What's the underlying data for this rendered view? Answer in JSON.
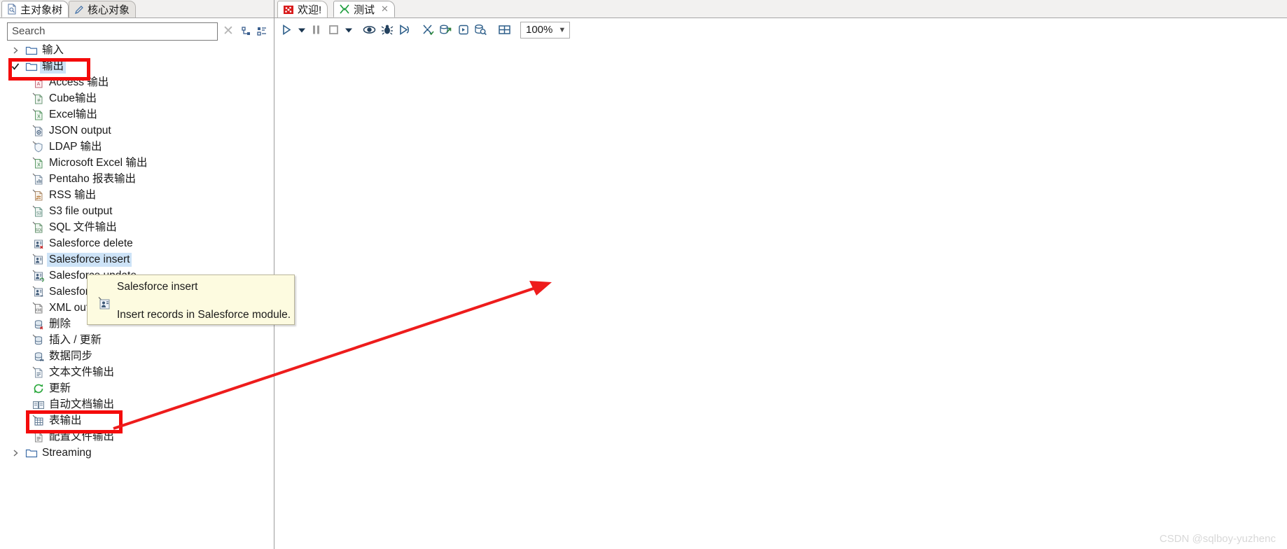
{
  "left_panel": {
    "tabs": [
      {
        "label": "主对象树",
        "icon": "document-tree-icon",
        "active": true
      },
      {
        "label": "核心对象",
        "icon": "pencil-icon",
        "active": false
      }
    ],
    "search": {
      "placeholder": "Search",
      "value": ""
    },
    "toolbar_icons": [
      {
        "name": "collapse-all-icon"
      },
      {
        "name": "expand-all-icon"
      }
    ],
    "clear_icon": "clear-x-icon",
    "tree": [
      {
        "label": "输入",
        "level": "root",
        "icon": "folder-icon",
        "twist": "collapsed"
      },
      {
        "label": "输出",
        "level": "root",
        "icon": "folder-icon",
        "twist": "expanded",
        "selected": true,
        "highlighted": true
      },
      {
        "label": "Access 输出",
        "level": "child",
        "icon": "access-output-icon"
      },
      {
        "label": "Cube输出",
        "level": "child",
        "icon": "cube-output-icon"
      },
      {
        "label": "Excel输出",
        "level": "child",
        "icon": "excel-output-icon"
      },
      {
        "label": "JSON output",
        "level": "child",
        "icon": "json-output-icon"
      },
      {
        "label": "LDAP 输出",
        "level": "child",
        "icon": "ldap-output-icon"
      },
      {
        "label": "Microsoft Excel 输出",
        "level": "child",
        "icon": "ms-excel-output-icon"
      },
      {
        "label": "Pentaho 报表输出",
        "level": "child",
        "icon": "pentaho-report-output-icon"
      },
      {
        "label": "RSS 输出",
        "level": "child",
        "icon": "rss-output-icon"
      },
      {
        "label": "S3 file output",
        "level": "child",
        "icon": "s3-file-output-icon"
      },
      {
        "label": "SQL 文件输出",
        "level": "child",
        "icon": "sql-file-output-icon"
      },
      {
        "label": "Salesforce delete",
        "level": "child",
        "icon": "salesforce-delete-icon"
      },
      {
        "label": "Salesforce insert",
        "level": "child",
        "icon": "salesforce-insert-icon",
        "selected": true
      },
      {
        "label": "Salesforce update",
        "level": "child",
        "icon": "salesforce-update-icon"
      },
      {
        "label": "Salesforce upsert",
        "level": "child",
        "icon": "salesforce-upsert-icon"
      },
      {
        "label": "XML output",
        "level": "child",
        "icon": "xml-output-icon"
      },
      {
        "label": "删除",
        "level": "child",
        "icon": "delete-icon"
      },
      {
        "label": "插入 / 更新",
        "level": "child",
        "icon": "insert-update-icon"
      },
      {
        "label": "数据同步",
        "level": "child",
        "icon": "data-sync-icon"
      },
      {
        "label": "文本文件输出",
        "level": "child",
        "icon": "text-file-output-icon"
      },
      {
        "label": "更新",
        "level": "child",
        "icon": "update-icon"
      },
      {
        "label": "自动文档输出",
        "level": "child",
        "icon": "auto-doc-output-icon"
      },
      {
        "label": "表输出",
        "level": "child",
        "icon": "table-output-icon",
        "highlighted": true
      },
      {
        "label": "配置文件输出",
        "level": "child",
        "icon": "properties-output-icon"
      },
      {
        "label": "Streaming",
        "level": "root",
        "icon": "folder-icon",
        "twist": "collapsed"
      }
    ]
  },
  "tooltip": {
    "title": "Salesforce insert",
    "description": "Insert records in Salesforce module.",
    "icon": "salesforce-insert-icon"
  },
  "right_panel": {
    "tabs": [
      {
        "label": "欢迎!",
        "icon": "welcome-icon",
        "active": false,
        "closeable": false
      },
      {
        "label": "测试",
        "icon": "transformation-icon",
        "active": true,
        "closeable": true,
        "close_label": "✕"
      }
    ],
    "toolbar": [
      {
        "name": "run-button",
        "icon": "play-icon"
      },
      {
        "name": "run-options-dropdown",
        "icon": "chevron-down-icon"
      },
      {
        "name": "pause-button",
        "icon": "pause-icon"
      },
      {
        "name": "stop-button",
        "icon": "stop-icon"
      },
      {
        "name": "stop-options-dropdown",
        "icon": "chevron-down-icon"
      },
      {
        "name": "preview-button",
        "icon": "eye-icon"
      },
      {
        "name": "debug-button",
        "icon": "bug-icon"
      },
      {
        "name": "replay-button",
        "icon": "play-outline-icon"
      },
      {
        "name": "verify-button",
        "icon": "verify-transformation-icon"
      },
      {
        "name": "impact-analysis-button",
        "icon": "impact-icon"
      },
      {
        "name": "generate-sql-button",
        "icon": "sql-scroll-icon"
      },
      {
        "name": "explore-database-button",
        "icon": "db-search-icon"
      },
      {
        "name": "show-grid-button",
        "icon": "grid-icon"
      }
    ],
    "zoom": {
      "value": "100%",
      "caret": "chevron-down-icon"
    }
  },
  "annotations": {
    "red_boxes": [
      "输出",
      "表输出"
    ],
    "arrow": {
      "name": "red-arrow-annotation",
      "color": "#ee1c1c"
    }
  },
  "watermark": "CSDN @sqlboy-yuzhenc",
  "colors": {
    "selection": "#cde3f7",
    "annotation_red": "#f40b0b",
    "tooltip_bg": "#fdfbe0",
    "tooltip_border": "#b9b59a"
  }
}
